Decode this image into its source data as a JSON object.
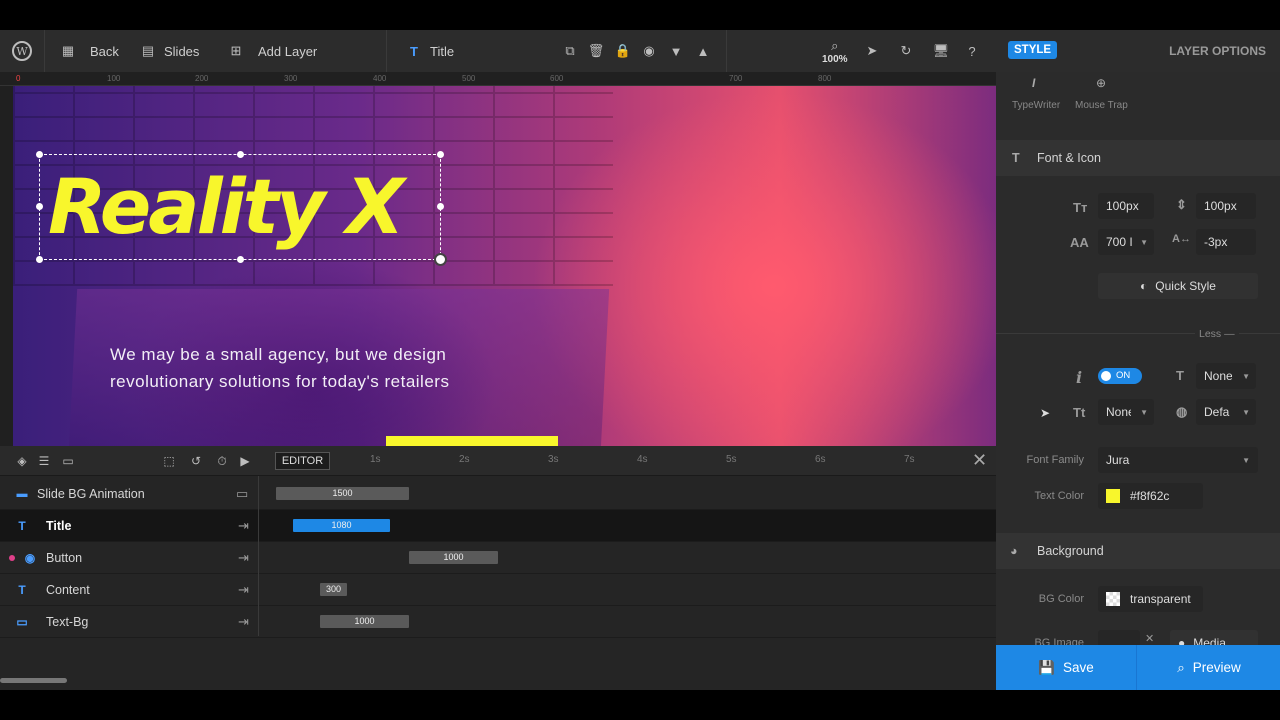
{
  "topbar": {
    "back_label": "Back",
    "slides_label": "Slides",
    "add_layer_label": "Add Layer",
    "layer_name": "Title",
    "zoom": "100%"
  },
  "ruler": {
    "ticks": [
      "0",
      "100",
      "200",
      "300",
      "400",
      "500",
      "600",
      "700",
      "800"
    ]
  },
  "canvas": {
    "title_text": "Reality X",
    "content_line1": "We may be a small agency, but we design",
    "content_line2": "revolutionary solutions for today's retailers"
  },
  "timeline": {
    "editor_label": "EDITOR",
    "time_marks": [
      "1s",
      "2s",
      "3s",
      "4s",
      "5s",
      "6s",
      "7s"
    ],
    "rows": [
      {
        "label": "Slide BG Animation",
        "duration": "1500"
      },
      {
        "label": "Title",
        "duration": "1080"
      },
      {
        "label": "Button",
        "duration": "1000"
      },
      {
        "label": "Content",
        "duration": "300"
      },
      {
        "label": "Text-Bg",
        "duration": "1000"
      }
    ]
  },
  "sidebar": {
    "style_tab": "STYLE",
    "layer_options": "LAYER OPTIONS",
    "typewriter": "TypeWriter",
    "mouse_trap": "Mouse Trap",
    "font_icon_title": "Font & Icon",
    "font_size": "100px",
    "line_height": "100px",
    "font_weight": "700 I",
    "letter_spacing": "-3px",
    "quick_style": "Quick Style",
    "less": "Less",
    "toggle_on": "ON",
    "text_transform": "None",
    "text_decoration": "None",
    "cursor": "Defa",
    "font_family_label": "Font Family",
    "font_family": "Jura",
    "text_color_label": "Text Color",
    "text_color": "#f8f62c",
    "background_title": "Background",
    "bg_color_label": "BG Color",
    "bg_color": "transparent",
    "bg_image_label": "BG Image",
    "media": "Media",
    "save": "Save",
    "preview": "Preview"
  },
  "colors": {
    "accent": "#1e88e5",
    "title_yellow": "#f8f62c",
    "panel": "#2b2b2b"
  }
}
